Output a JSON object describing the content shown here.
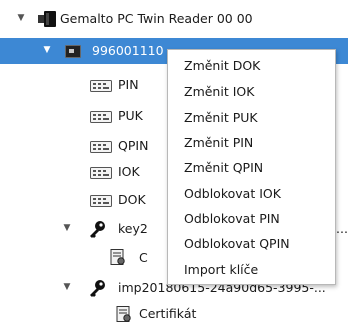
{
  "tree": {
    "reader": {
      "label": "Gemalto PC Twin Reader 00 00",
      "toggle": "▼",
      "icon": "card-reader-icon"
    },
    "card": {
      "label": "996001110",
      "toggle": "▼",
      "icon": "smart-card-icon",
      "selection_color": "#3d88d4"
    },
    "items": [
      {
        "label": "PIN",
        "icon": "pin-pad-icon"
      },
      {
        "label": "PUK",
        "icon": "pin-pad-icon"
      },
      {
        "label": "QPIN",
        "icon": "pin-pad-icon"
      },
      {
        "label": "IOK",
        "icon": "pin-pad-icon"
      },
      {
        "label": "DOK",
        "icon": "pin-pad-icon"
      }
    ],
    "key1": {
      "label": "key2",
      "tail": "...",
      "toggle": "▼",
      "icon": "key-icon"
    },
    "cert1": {
      "label": "C",
      "icon": "certificate-icon"
    },
    "key2": {
      "label": "imp20180615-24a90d65-3995-...",
      "toggle": "▼",
      "icon": "key-icon"
    },
    "cert2": {
      "label": "Certifikát",
      "icon": "certificate-icon"
    }
  },
  "context_menu": {
    "items": [
      "Změnit DOK",
      "Změnit IOK",
      "Změnit PUK",
      "Změnit PIN",
      "Změnit QPIN",
      "Odblokovat IOK",
      "Odblokovat PIN",
      "Odblokovat QPIN",
      "Import klíče"
    ]
  }
}
